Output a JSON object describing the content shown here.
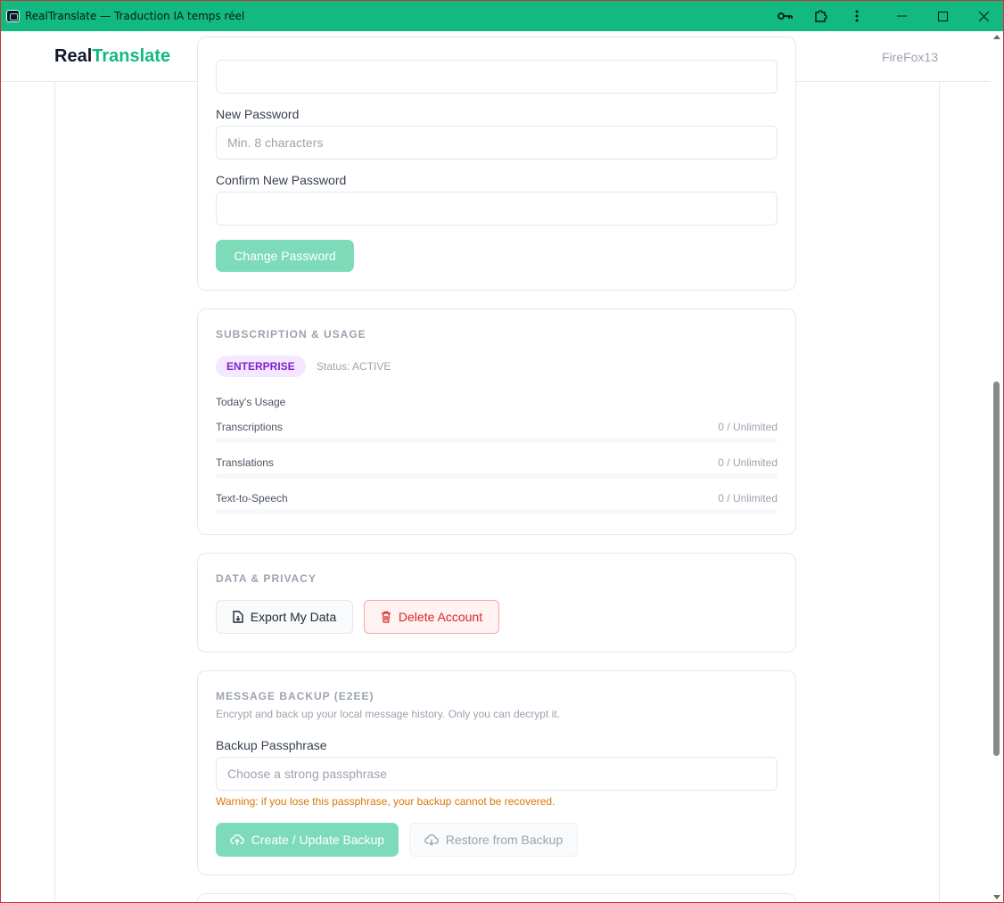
{
  "window": {
    "title": "RealTranslate — Traduction IA temps réel",
    "controls": [
      "key-icon",
      "extensions-icon",
      "more-icon",
      "minimize-icon",
      "maximize-icon",
      "close-icon"
    ]
  },
  "header": {
    "logo_part1": "Real",
    "logo_part2": "Translate",
    "user": "FireFox13"
  },
  "password": {
    "new_label": "New Password",
    "new_placeholder": "Min. 8 characters",
    "confirm_label": "Confirm New Password",
    "confirm_placeholder": "",
    "button": "Change Password"
  },
  "subscription": {
    "title": "SUBSCRIPTION & USAGE",
    "plan": "ENTERPRISE",
    "status": "Status: ACTIVE",
    "usage_heading": "Today's Usage",
    "rows": [
      {
        "name": "Transcriptions",
        "value": "0 / Unlimited",
        "fraction": 0
      },
      {
        "name": "Translations",
        "value": "0 / Unlimited",
        "fraction": 0
      },
      {
        "name": "Text-to-Speech",
        "value": "0 / Unlimited",
        "fraction": 0
      }
    ]
  },
  "privacy": {
    "title": "DATA & PRIVACY",
    "export": "Export My Data",
    "delete": "Delete Account"
  },
  "backup": {
    "title": "MESSAGE BACKUP (E2EE)",
    "description": "Encrypt and back up your local message history. Only you can decrypt it.",
    "passphrase_label": "Backup Passphrase",
    "passphrase_placeholder": "Choose a strong passphrase",
    "warning": "Warning: if you lose this passphrase, your backup cannot be recovered.",
    "create": "Create / Update Backup",
    "restore": "Restore from Backup"
  },
  "colors": {
    "accent": "#10b981",
    "titlebar": "#12b981",
    "plan_badge": "#7e22ce",
    "danger": "#dc2626",
    "warning": "#d97706"
  }
}
